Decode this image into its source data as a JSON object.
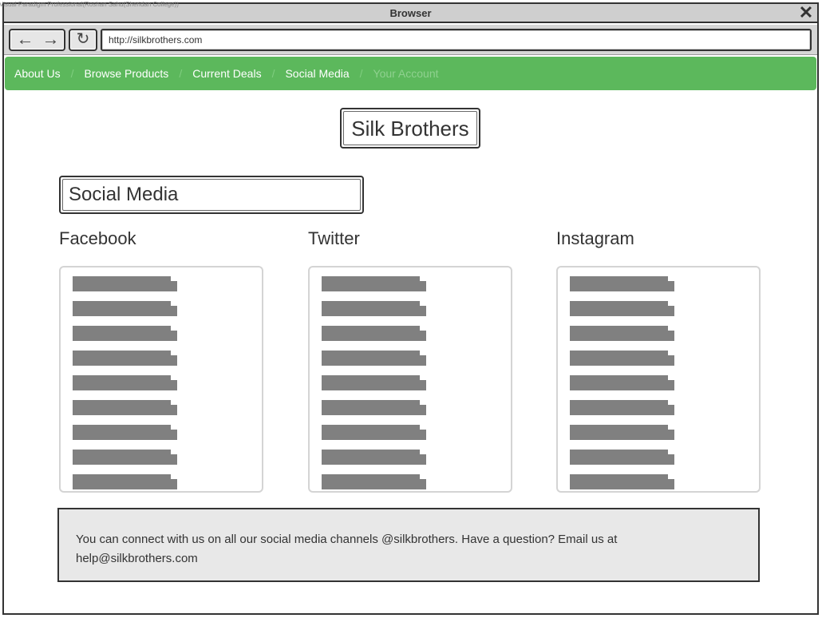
{
  "watermark": "Visual Paradigm Professional(Roshan Sahu(Sheridan College))",
  "window": {
    "title": "Browser",
    "close_glyph": "✕"
  },
  "toolbar": {
    "back_glyph": "←",
    "forward_glyph": "→",
    "reload_glyph": "↻",
    "url": "http://silkbrothers.com"
  },
  "nav": {
    "items": [
      {
        "label": "About Us",
        "disabled": false
      },
      {
        "label": "Browse Products",
        "disabled": false
      },
      {
        "label": "Current Deals",
        "disabled": false
      },
      {
        "label": "Social Media",
        "disabled": false
      },
      {
        "label": "Your Account",
        "disabled": true
      }
    ],
    "separator": "/"
  },
  "brand": {
    "title": "Silk Brothers"
  },
  "section": {
    "title": "Social Media"
  },
  "columns": [
    {
      "title": "Facebook",
      "placeholder_lines": 9
    },
    {
      "title": "Twitter",
      "placeholder_lines": 9
    },
    {
      "title": "Instagram",
      "placeholder_lines": 9
    }
  ],
  "footer": {
    "text": "You can connect with us on all our social media channels @silkbrothers. Have a question? Email us at help@silkbrothers.com"
  },
  "colors": {
    "nav_bg": "#5cb85c",
    "placeholder": "#808080",
    "footer_bg": "#e8e8e8"
  }
}
